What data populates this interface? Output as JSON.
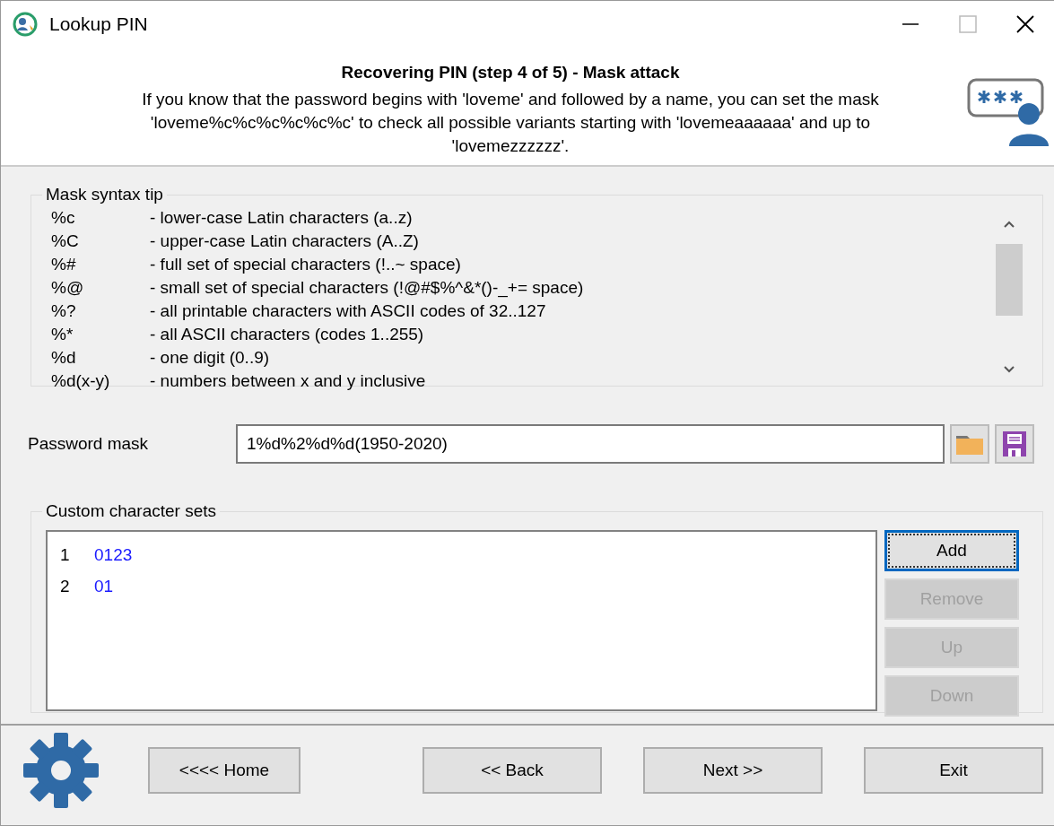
{
  "window": {
    "title": "Lookup PIN"
  },
  "header": {
    "title": "Recovering PIN (step 4 of 5) - Mask attack",
    "description": "If you know that the password begins with 'loveme' and followed by a name, you can set the mask 'loveme%c%c%c%c%c%c' to check all possible variants starting with 'lovemeaaaaaa' and up to 'lovemezzzzzz'."
  },
  "mask_syntax_tip": {
    "title": "Mask syntax tip",
    "rows": [
      {
        "code": "%c",
        "description": "- lower-case Latin characters  (a..z)"
      },
      {
        "code": "%C",
        "description": "- upper-case Latin characters (A..Z)"
      },
      {
        "code": "%#",
        "description": "- full set of special characters (!..~ space)"
      },
      {
        "code": "%@",
        "description": "- small set of special characters (!@#$%^&*()-_+= space)"
      },
      {
        "code": "%?",
        "description": "- all printable characters with ASCII codes of 32..127"
      },
      {
        "code": "%*",
        "description": "- all ASCII characters (codes 1..255)"
      },
      {
        "code": "%d",
        "description": "- one digit (0..9)"
      },
      {
        "code": "%d(x-y)",
        "description": "- numbers between x and y inclusive"
      }
    ]
  },
  "password_mask": {
    "label": "Password mask",
    "value": "1%d%2%d%d(1950-2020)"
  },
  "custom_character_sets": {
    "title": "Custom character sets",
    "items": [
      {
        "number": "1",
        "value": "0123"
      },
      {
        "number": "2",
        "value": "01"
      }
    ],
    "buttons": [
      {
        "label": "Add",
        "disabled": false,
        "focused": true
      },
      {
        "label": "Remove",
        "disabled": true,
        "focused": false
      },
      {
        "label": "Up",
        "disabled": true,
        "focused": false
      },
      {
        "label": "Down",
        "disabled": true,
        "focused": false
      }
    ]
  },
  "footer_buttons": [
    {
      "label": "<<<< Home"
    },
    {
      "label": "<< Back"
    },
    {
      "label": "Next >>"
    },
    {
      "label": "Exit"
    }
  ]
}
